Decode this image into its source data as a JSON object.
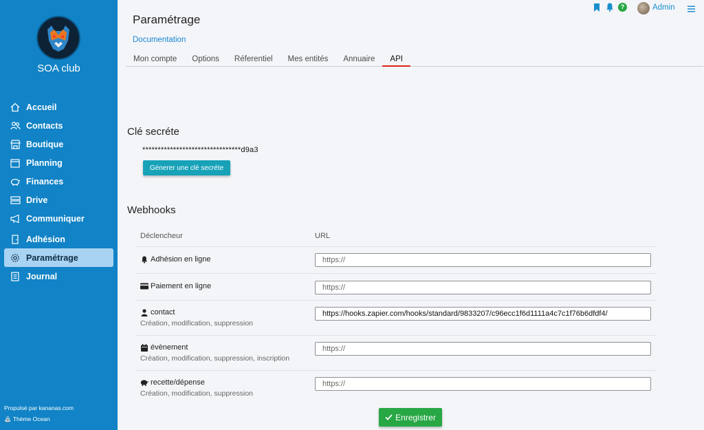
{
  "app": {
    "club_name": "SOA club",
    "footer_powered": "Propulsé par kananas.com",
    "footer_theme": "Thème Ocean",
    "brand_color": "#1183c6"
  },
  "sidebar": {
    "items": [
      {
        "label": "Accueil",
        "icon": "home-icon"
      },
      {
        "label": "Contacts",
        "icon": "users-icon"
      },
      {
        "label": "Boutique",
        "icon": "store-icon"
      },
      {
        "label": "Planning",
        "icon": "calendar-icon"
      },
      {
        "label": "Finances",
        "icon": "piggy-bank-icon"
      },
      {
        "label": "Drive",
        "icon": "drive-icon"
      },
      {
        "label": "Communiquer",
        "icon": "megaphone-icon"
      },
      {
        "label": "Adhésion",
        "icon": "door-icon"
      },
      {
        "label": "Paramétrage",
        "icon": "gear-icon",
        "active": true
      },
      {
        "label": "Journal",
        "icon": "journal-icon"
      }
    ]
  },
  "topbar": {
    "user_name": "Admin",
    "help_label": "?"
  },
  "header": {
    "title": "Paramétrage",
    "doc_link": "Documentation",
    "tabs": [
      "Mon compte",
      "Options",
      "Réferentiel",
      "Mes entités",
      "Annuaire",
      "API"
    ],
    "active_tab": "API"
  },
  "secret_key": {
    "title": "Clé secréte",
    "value": "********************************d9a3",
    "generate_label": "Génerer une clé secréte"
  },
  "webhooks": {
    "title": "Webhooks",
    "col_trigger": "Déclencheur",
    "col_url": "URL",
    "rows": [
      {
        "trigger": "Adhésion en ligne",
        "icon": "bell-icon",
        "desc": "",
        "value": "",
        "placeholder": "https://"
      },
      {
        "trigger": "Paiement en ligne",
        "icon": "credit-card-icon",
        "desc": "",
        "value": "",
        "placeholder": "https://"
      },
      {
        "trigger": "contact",
        "icon": "user-icon",
        "desc": "Création, modification, suppression",
        "value": "https://hooks.zapier.com/hooks/standard/9833207/c96ecc1f6d1111a4c7c1f76b6dfdf4/",
        "placeholder": "https://"
      },
      {
        "trigger": "évènement",
        "icon": "calendar-icon",
        "desc": "Création, modification, suppression, inscription",
        "value": "",
        "placeholder": "https://"
      },
      {
        "trigger": "recette/dépense",
        "icon": "piggy-bank-icon",
        "desc": "Création, modification, suppression",
        "value": "",
        "placeholder": "https://"
      }
    ],
    "save_label": "Enregistrer"
  }
}
